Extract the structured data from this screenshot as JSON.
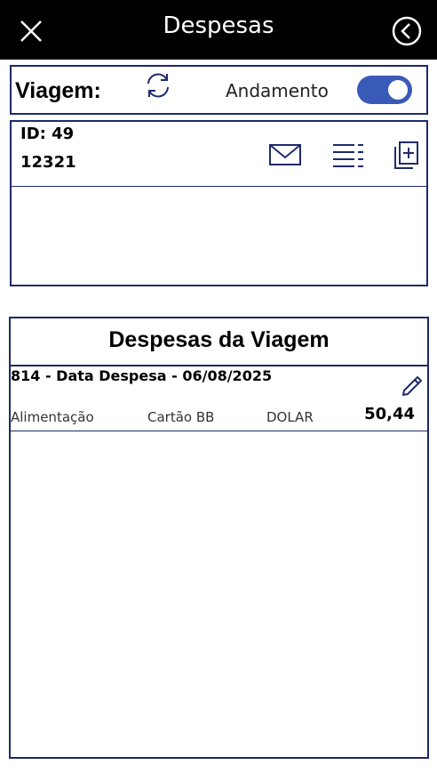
{
  "header": {
    "title": "Despesas"
  },
  "viagem": {
    "label": "Viagem:",
    "status_label": "Andamento",
    "toggle_on": true
  },
  "trip": {
    "id_text": "ID: 49",
    "number": "12321"
  },
  "expenses": {
    "title": "Despesas da Viagem",
    "items": [
      {
        "header": "814 - Data Despesa - 06/08/2025",
        "category": "Alimentação",
        "card": "Cartão BB",
        "currency": "DOLAR",
        "amount": "50,44"
      }
    ]
  },
  "colors": {
    "accent": "#3a5ab8",
    "border": "#1f2a6b",
    "header_bg": "#000000"
  }
}
